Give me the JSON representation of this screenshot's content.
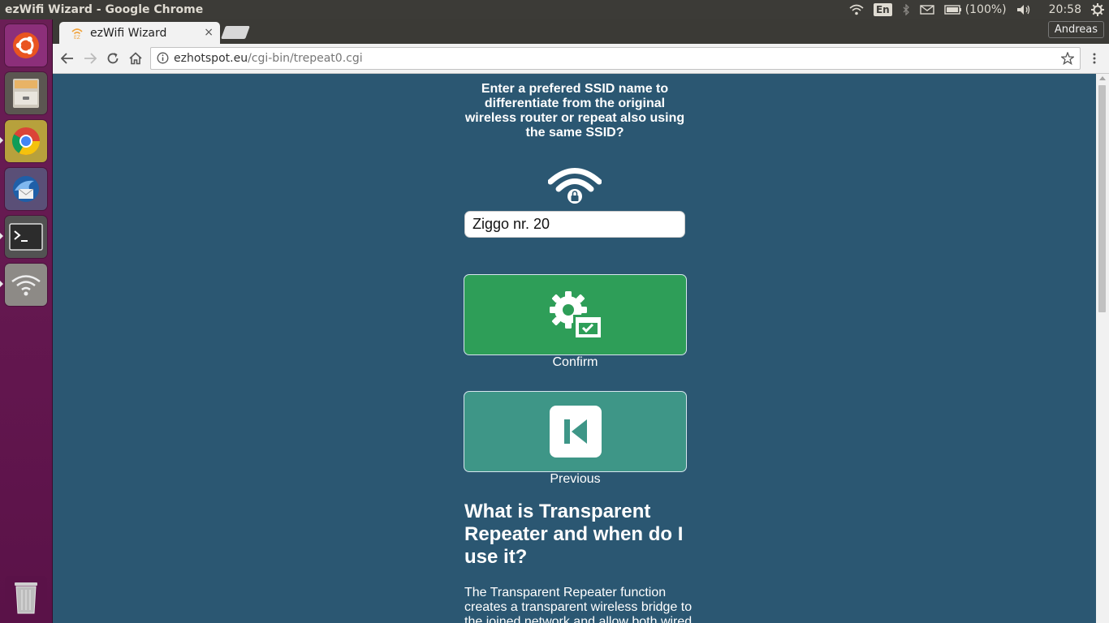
{
  "window": {
    "title": "ezWifi Wizard - Google Chrome",
    "indicators": {
      "language": "En",
      "battery": "(100%)",
      "clock": "20:58"
    }
  },
  "launcher": {
    "items": [
      "ubuntu-dash",
      "files",
      "chrome",
      "thunderbird",
      "terminal",
      "network",
      "trash"
    ]
  },
  "browser": {
    "tab_title": "ezWifi Wizard",
    "tab_close": "×",
    "user_name": "Andreas",
    "url_host": "ezhotspot.eu",
    "url_path": "/cgi-bin/trepeat0.cgi"
  },
  "page": {
    "prompt": "Enter a prefered SSID name to differentiate from the original wireless router or repeat also using the same SSID?",
    "ssid_value": "Ziggo nr. 20",
    "confirm_label": "Confirm",
    "previous_label": "Previous",
    "faq_heading": "What is Transparent Repeater and when do I use it?",
    "faq_body": "The Transparent Repeater function creates a transparent wireless bridge to the joined network and allow both wired"
  },
  "colors": {
    "page_background": "#2b5772",
    "confirm_button": "#2e9e58",
    "previous_button": "#3e9687",
    "launcher": "#62164e",
    "top_panel": "#3c3b37"
  }
}
